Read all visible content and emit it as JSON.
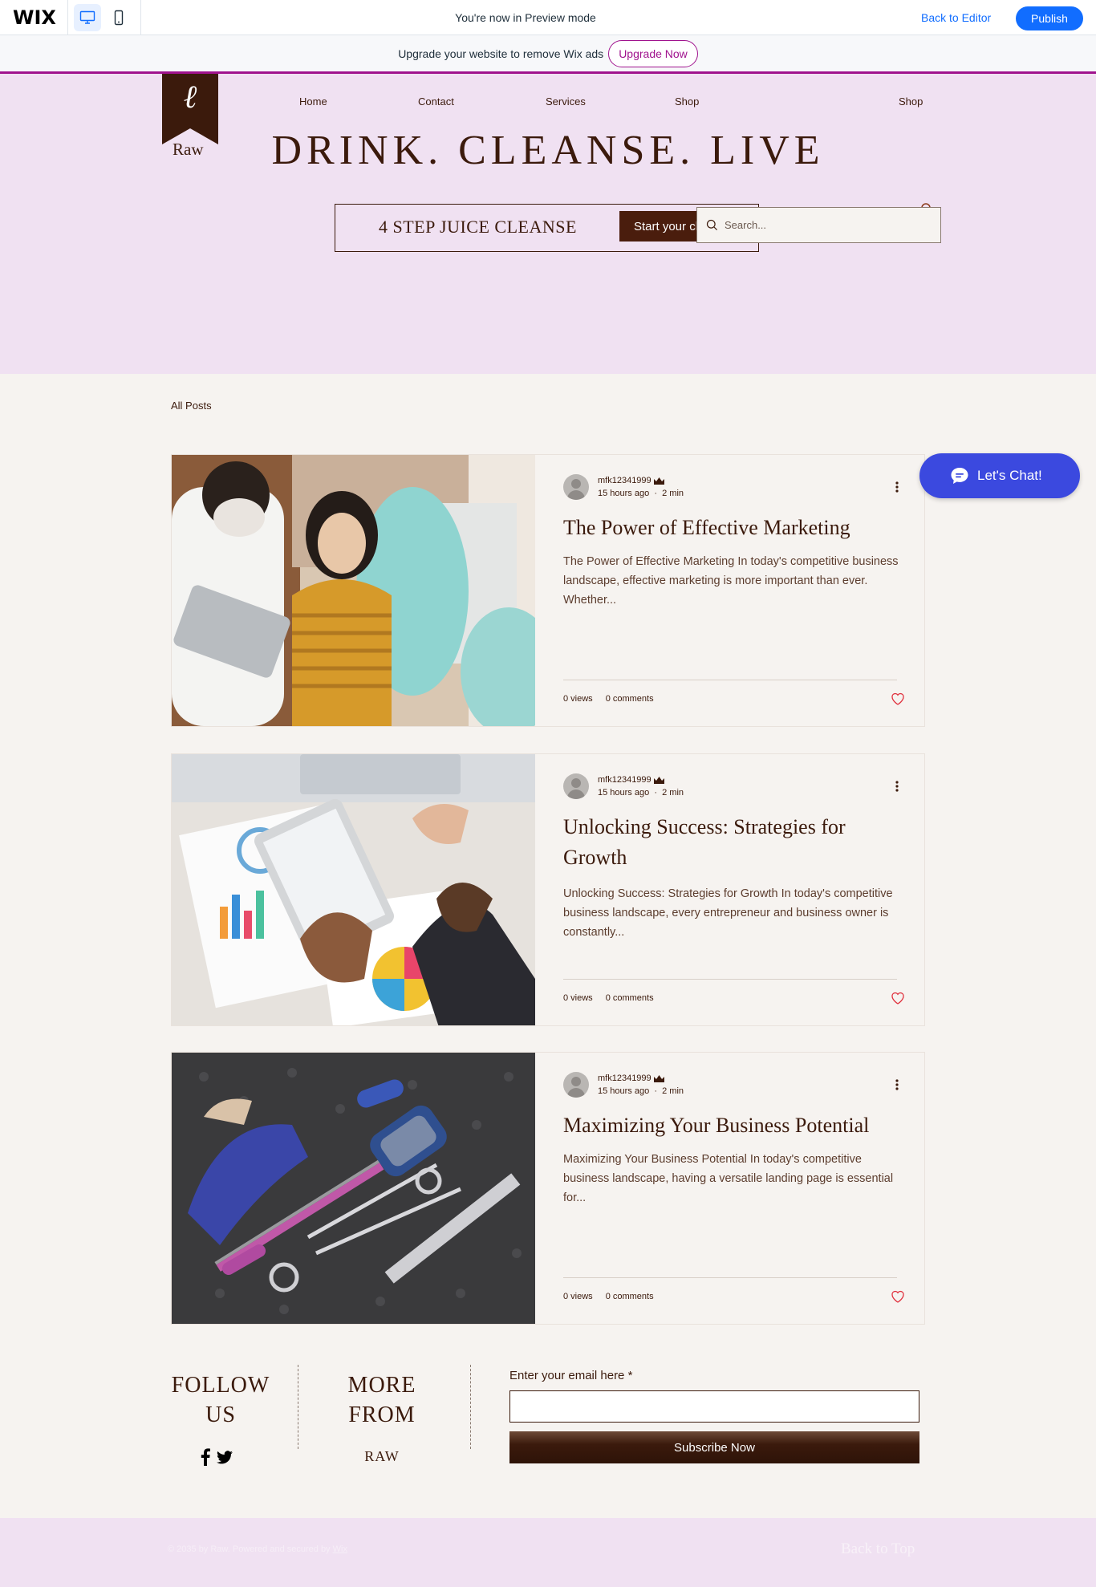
{
  "wixbar": {
    "logo": "WIX",
    "preview_text": "You're now in Preview mode",
    "back_to_editor": "Back to Editor",
    "publish": "Publish"
  },
  "ads": {
    "text": "Upgrade your website to remove Wix ads",
    "upgrade_button": "Upgrade Now",
    "accent_color": "#a0138e"
  },
  "header": {
    "brand": "Raw",
    "logo_glyph": "ℓ",
    "nav": [
      "Home",
      "Contact",
      "Services",
      "Shop",
      "Shop"
    ],
    "headline": "DRINK. CLEANSE. LIVE",
    "cleanse_text": "4 STEP JUICE CLEANSE",
    "cleanse_button": "Start your cleanse",
    "search_placeholder": "Search...",
    "background_color": "#f0e1f2"
  },
  "blog": {
    "all_posts": "All Posts",
    "posts": [
      {
        "author": "mfk12341999",
        "time": "15 hours ago",
        "read_time": "2 min",
        "title": "The Power of Effective Marketing",
        "excerpt": "The Power of Effective Marketing In today's competitive business landscape, effective marketing is more important than ever. Whether...",
        "views": "0 views",
        "comments": "0 comments"
      },
      {
        "author": "mfk12341999",
        "time": "15 hours ago",
        "read_time": "2 min",
        "title": "Unlocking Success: Strategies for Growth",
        "excerpt": "Unlocking Success: Strategies for Growth In today's competitive business landscape, every entrepreneur and business owner is constantly...",
        "views": "0 views",
        "comments": "0 comments"
      },
      {
        "author": "mfk12341999",
        "time": "15 hours ago",
        "read_time": "2 min",
        "title": "Maximizing Your Business Potential",
        "excerpt": "Maximizing Your Business Potential In today's competitive business landscape, having a versatile landing page is essential for...",
        "views": "0 views",
        "comments": "0 comments"
      }
    ]
  },
  "chat": {
    "label": "Let's Chat!",
    "color": "#3b49df"
  },
  "newsletter": {
    "follow": "FOLLOW US",
    "more_from": "MORE FROM",
    "raw": "RAW",
    "email_label": "Enter your email here *",
    "subscribe": "Subscribe Now"
  },
  "footer": {
    "copyright": "© 2035 by Raw. Powered and secured by",
    "wix_link": "Wix",
    "back_to_top": "Back to Top"
  },
  "icons": [
    "desktop-icon",
    "mobile-icon",
    "search-icon",
    "crown-icon",
    "more-icon",
    "heart-icon",
    "chat-icon",
    "facebook-icon",
    "twitter-icon"
  ]
}
